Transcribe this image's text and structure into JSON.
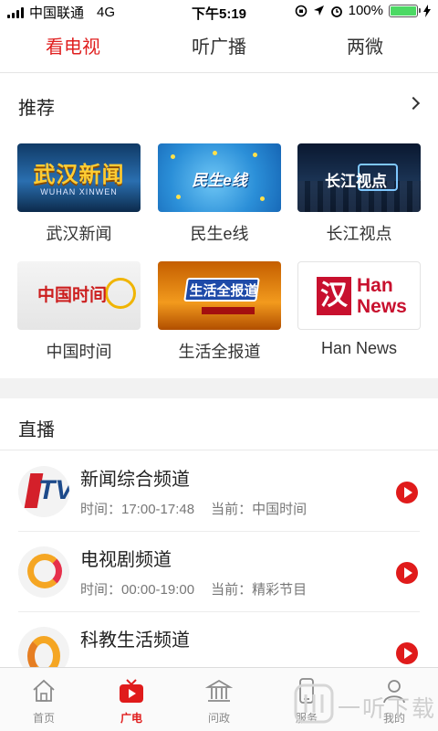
{
  "status_bar": {
    "carrier": "中国联通",
    "network": "4G",
    "time": "下午5:19",
    "battery": "100%"
  },
  "top_tabs": [
    {
      "label": "看电视",
      "active": true
    },
    {
      "label": "听广播",
      "active": false
    },
    {
      "label": "两微",
      "active": false
    }
  ],
  "recommend": {
    "title": "推荐",
    "items": [
      {
        "label": "武汉新闻",
        "thumb_title": "武汉新闻",
        "thumb_sub": "WUHAN XINWEN"
      },
      {
        "label": "民生e线",
        "thumb_title": "民生e线"
      },
      {
        "label": "长江视点",
        "thumb_title": "长江视点"
      },
      {
        "label": "中国时间",
        "thumb_title": "中国时间"
      },
      {
        "label": "生活全报道",
        "thumb_title": "生活全报道"
      },
      {
        "label": "Han News",
        "thumb_mark": "汉",
        "thumb_text_1": "Han",
        "thumb_text_2": "News"
      }
    ]
  },
  "live": {
    "title": "直播",
    "channels": [
      {
        "name": "新闻综合频道",
        "time_label": "时间：17:00-17:48",
        "current_label": "当前：中国时间"
      },
      {
        "name": "电视剧频道",
        "time_label": "时间：00:00-19:00",
        "current_label": "当前：精彩节目"
      },
      {
        "name": "科教生活频道",
        "time_label": "",
        "current_label": ""
      }
    ]
  },
  "tabbar": [
    {
      "label": "首页",
      "icon": "home-icon",
      "active": false
    },
    {
      "label": "广电",
      "icon": "tv-icon",
      "active": true
    },
    {
      "label": "问政",
      "icon": "building-icon",
      "active": false
    },
    {
      "label": "服务",
      "icon": "phone-icon",
      "active": false
    },
    {
      "label": "我的",
      "icon": "user-icon",
      "active": false
    }
  ],
  "watermark": {
    "text": "一听下载"
  },
  "colors": {
    "accent": "#e01b1b",
    "tab_inactive": "#8a8a8a",
    "band": "#f2f2f2"
  }
}
